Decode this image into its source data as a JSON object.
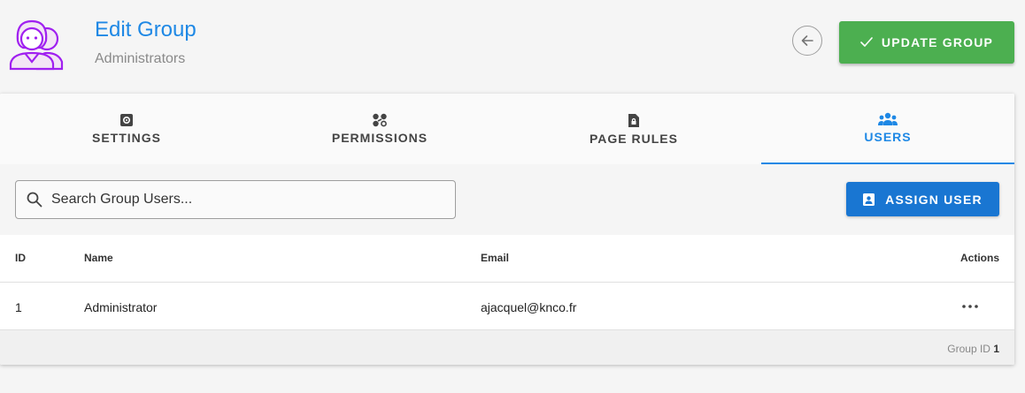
{
  "header": {
    "title": "Edit Group",
    "subtitle": "Administrators",
    "update_label": "UPDATE GROUP",
    "avatar_icon": "group-avatar-icon",
    "back_icon": "arrow-left-icon",
    "accent_color": "#1e88e5",
    "update_color": "#4caf50"
  },
  "tabs": [
    {
      "label": "SETTINGS",
      "icon": "settings-icon"
    },
    {
      "label": "PERMISSIONS",
      "icon": "permissions-icon"
    },
    {
      "label": "PAGE RULES",
      "icon": "page-lock-icon"
    },
    {
      "label": "USERS",
      "icon": "users-icon",
      "active": true
    }
  ],
  "toolbar": {
    "search_placeholder": "Search Group Users...",
    "assign_label": "ASSIGN USER",
    "assign_color": "#1976d2"
  },
  "table": {
    "columns": {
      "id": "ID",
      "name": "Name",
      "email": "Email",
      "actions": "Actions"
    },
    "rows": [
      {
        "id": "1",
        "name": "Administrator",
        "email": "ajacquel@knco.fr"
      }
    ]
  },
  "footer": {
    "label": "Group ID",
    "value": "1"
  }
}
